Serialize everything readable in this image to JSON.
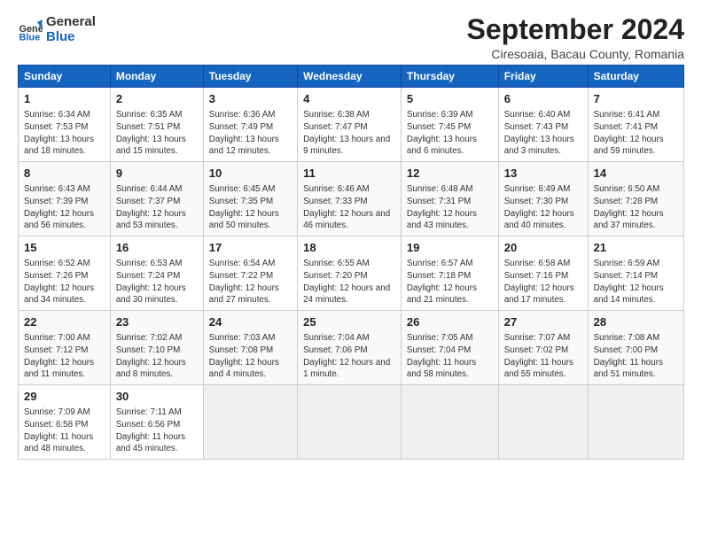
{
  "header": {
    "logo_line1": "General",
    "logo_line2": "Blue",
    "title": "September 2024",
    "subtitle": "Ciresoaia, Bacau County, Romania"
  },
  "columns": [
    "Sunday",
    "Monday",
    "Tuesday",
    "Wednesday",
    "Thursday",
    "Friday",
    "Saturday"
  ],
  "weeks": [
    [
      {
        "day": "1",
        "info": "Sunrise: 6:34 AM\nSunset: 7:53 PM\nDaylight: 13 hours and 18 minutes."
      },
      {
        "day": "2",
        "info": "Sunrise: 6:35 AM\nSunset: 7:51 PM\nDaylight: 13 hours and 15 minutes."
      },
      {
        "day": "3",
        "info": "Sunrise: 6:36 AM\nSunset: 7:49 PM\nDaylight: 13 hours and 12 minutes."
      },
      {
        "day": "4",
        "info": "Sunrise: 6:38 AM\nSunset: 7:47 PM\nDaylight: 13 hours and 9 minutes."
      },
      {
        "day": "5",
        "info": "Sunrise: 6:39 AM\nSunset: 7:45 PM\nDaylight: 13 hours and 6 minutes."
      },
      {
        "day": "6",
        "info": "Sunrise: 6:40 AM\nSunset: 7:43 PM\nDaylight: 13 hours and 3 minutes."
      },
      {
        "day": "7",
        "info": "Sunrise: 6:41 AM\nSunset: 7:41 PM\nDaylight: 12 hours and 59 minutes."
      }
    ],
    [
      {
        "day": "8",
        "info": "Sunrise: 6:43 AM\nSunset: 7:39 PM\nDaylight: 12 hours and 56 minutes."
      },
      {
        "day": "9",
        "info": "Sunrise: 6:44 AM\nSunset: 7:37 PM\nDaylight: 12 hours and 53 minutes."
      },
      {
        "day": "10",
        "info": "Sunrise: 6:45 AM\nSunset: 7:35 PM\nDaylight: 12 hours and 50 minutes."
      },
      {
        "day": "11",
        "info": "Sunrise: 6:46 AM\nSunset: 7:33 PM\nDaylight: 12 hours and 46 minutes."
      },
      {
        "day": "12",
        "info": "Sunrise: 6:48 AM\nSunset: 7:31 PM\nDaylight: 12 hours and 43 minutes."
      },
      {
        "day": "13",
        "info": "Sunrise: 6:49 AM\nSunset: 7:30 PM\nDaylight: 12 hours and 40 minutes."
      },
      {
        "day": "14",
        "info": "Sunrise: 6:50 AM\nSunset: 7:28 PM\nDaylight: 12 hours and 37 minutes."
      }
    ],
    [
      {
        "day": "15",
        "info": "Sunrise: 6:52 AM\nSunset: 7:26 PM\nDaylight: 12 hours and 34 minutes."
      },
      {
        "day": "16",
        "info": "Sunrise: 6:53 AM\nSunset: 7:24 PM\nDaylight: 12 hours and 30 minutes."
      },
      {
        "day": "17",
        "info": "Sunrise: 6:54 AM\nSunset: 7:22 PM\nDaylight: 12 hours and 27 minutes."
      },
      {
        "day": "18",
        "info": "Sunrise: 6:55 AM\nSunset: 7:20 PM\nDaylight: 12 hours and 24 minutes."
      },
      {
        "day": "19",
        "info": "Sunrise: 6:57 AM\nSunset: 7:18 PM\nDaylight: 12 hours and 21 minutes."
      },
      {
        "day": "20",
        "info": "Sunrise: 6:58 AM\nSunset: 7:16 PM\nDaylight: 12 hours and 17 minutes."
      },
      {
        "day": "21",
        "info": "Sunrise: 6:59 AM\nSunset: 7:14 PM\nDaylight: 12 hours and 14 minutes."
      }
    ],
    [
      {
        "day": "22",
        "info": "Sunrise: 7:00 AM\nSunset: 7:12 PM\nDaylight: 12 hours and 11 minutes."
      },
      {
        "day": "23",
        "info": "Sunrise: 7:02 AM\nSunset: 7:10 PM\nDaylight: 12 hours and 8 minutes."
      },
      {
        "day": "24",
        "info": "Sunrise: 7:03 AM\nSunset: 7:08 PM\nDaylight: 12 hours and 4 minutes."
      },
      {
        "day": "25",
        "info": "Sunrise: 7:04 AM\nSunset: 7:06 PM\nDaylight: 12 hours and 1 minute."
      },
      {
        "day": "26",
        "info": "Sunrise: 7:05 AM\nSunset: 7:04 PM\nDaylight: 11 hours and 58 minutes."
      },
      {
        "day": "27",
        "info": "Sunrise: 7:07 AM\nSunset: 7:02 PM\nDaylight: 11 hours and 55 minutes."
      },
      {
        "day": "28",
        "info": "Sunrise: 7:08 AM\nSunset: 7:00 PM\nDaylight: 11 hours and 51 minutes."
      }
    ],
    [
      {
        "day": "29",
        "info": "Sunrise: 7:09 AM\nSunset: 6:58 PM\nDaylight: 11 hours and 48 minutes."
      },
      {
        "day": "30",
        "info": "Sunrise: 7:11 AM\nSunset: 6:56 PM\nDaylight: 11 hours and 45 minutes."
      },
      null,
      null,
      null,
      null,
      null
    ]
  ]
}
